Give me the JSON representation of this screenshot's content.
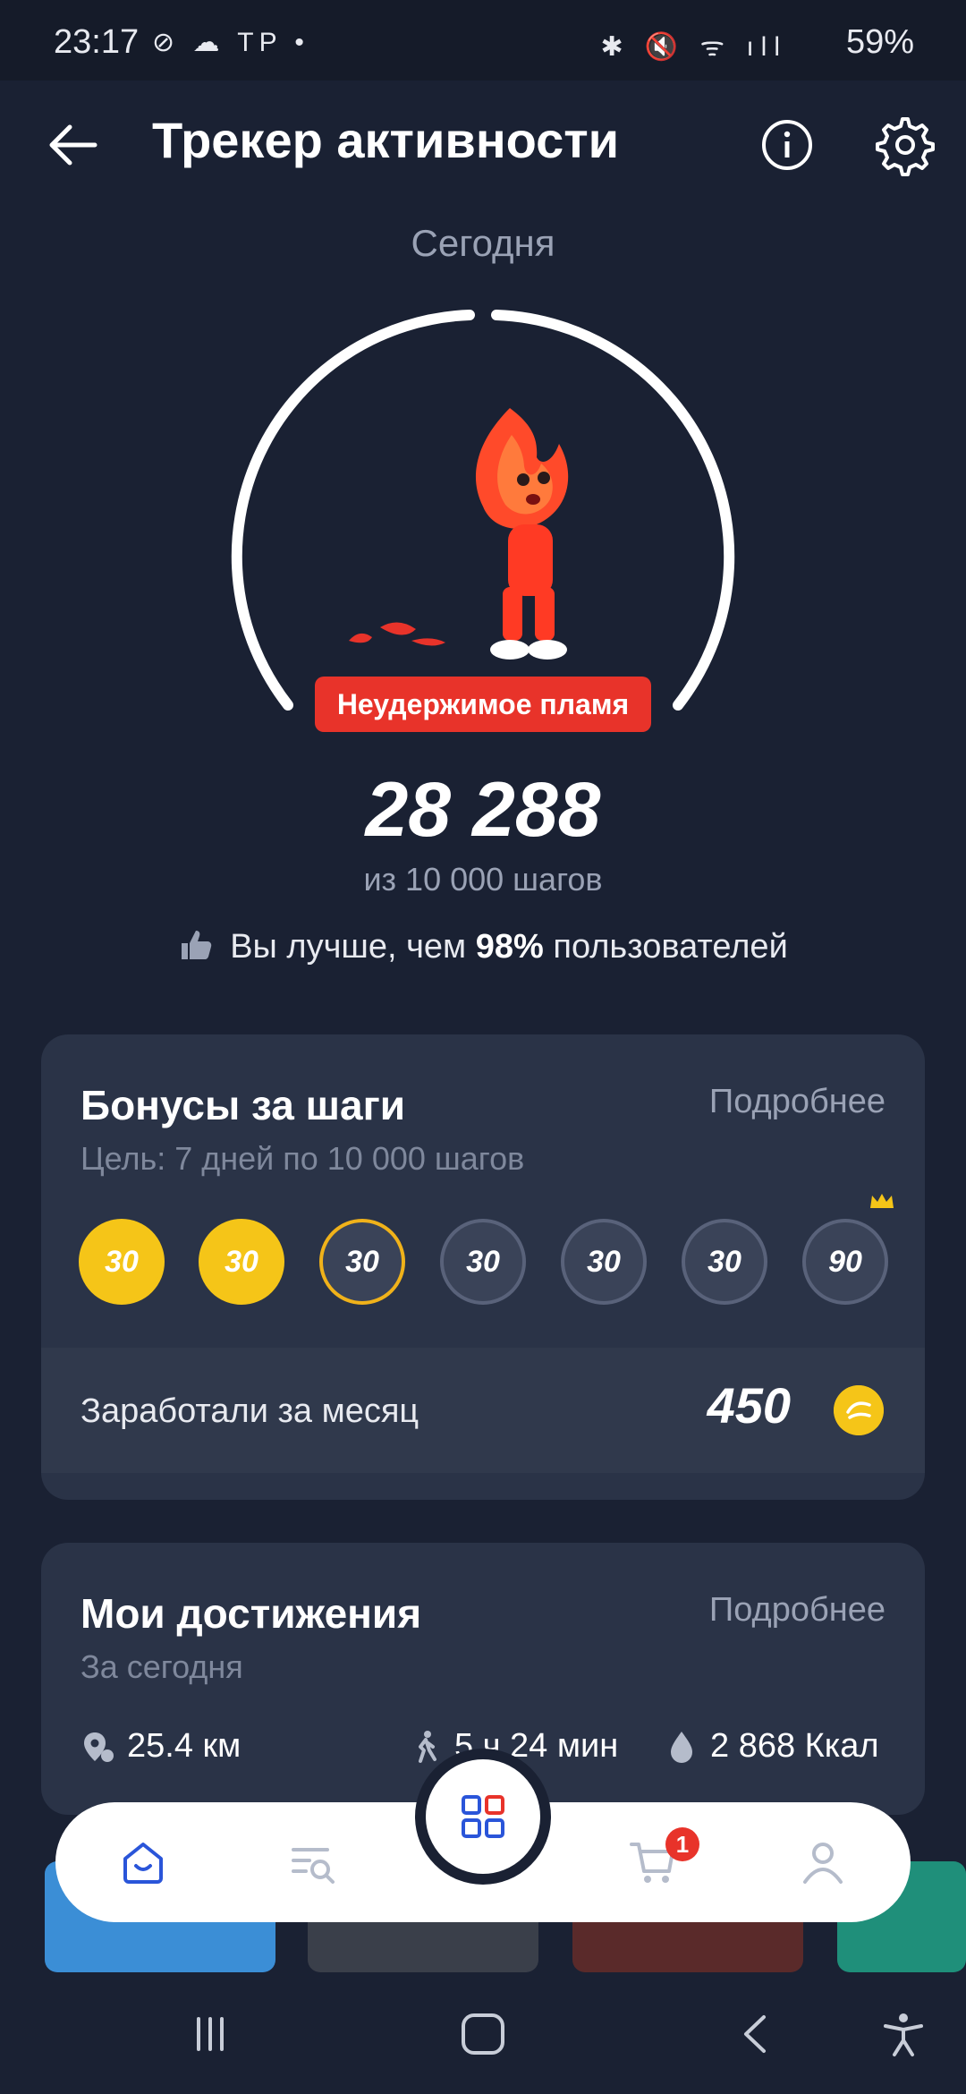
{
  "status_bar": {
    "time": "23:17",
    "left_icons": "⊘ ☁ TP •",
    "right_icons": "✱ 🔇 ᯤ ıll",
    "battery": "59%"
  },
  "header": {
    "title": "Трекер активности"
  },
  "today": {
    "label": "Сегодня",
    "badge": "Неудержимое пламя",
    "steps": "28 288",
    "goal": "из 10 000 шагов",
    "better_prefix": "Вы лучше, чем",
    "better_value": "98%",
    "better_suffix": "пользователей"
  },
  "bonus_card": {
    "title": "Бонусы за шаги",
    "link": "Подробнее",
    "subtitle": "Цель: 7 дней по 10 000 шагов",
    "coins": [
      {
        "value": "30",
        "state": "earned"
      },
      {
        "value": "30",
        "state": "earned"
      },
      {
        "value": "30",
        "state": "current"
      },
      {
        "value": "30",
        "state": "pending"
      },
      {
        "value": "30",
        "state": "pending"
      },
      {
        "value": "30",
        "state": "pending"
      },
      {
        "value": "90",
        "state": "pending"
      }
    ],
    "earned_label": "Заработали за месяц",
    "earned_value": "450"
  },
  "achievements_card": {
    "title": "Мои достижения",
    "link": "Подробнее",
    "subtitle": "За сегодня",
    "distance": "25.4 км",
    "time": "5 ч 24 мин",
    "calories": "2 868 Ккал"
  },
  "bottom_nav": {
    "cart_count": "1"
  },
  "colors": {
    "background": "#1a2133",
    "card": "#2a3347",
    "accent_red": "#e8332a",
    "gold": "#f5c518",
    "nav_blue": "#2a55d9"
  }
}
